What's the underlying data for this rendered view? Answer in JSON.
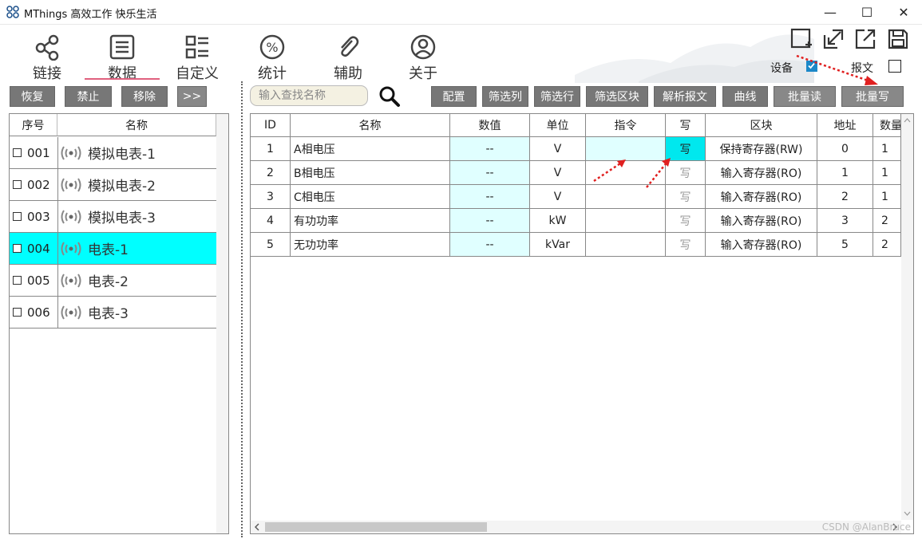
{
  "window": {
    "title": "MThings 高效工作 快乐生活",
    "controls": {
      "minimize": "—",
      "maximize": "☐",
      "close": "✕"
    }
  },
  "nav": {
    "items": [
      {
        "label": "链接",
        "icon": "share-icon"
      },
      {
        "label": "数据",
        "icon": "list-icon",
        "active": true
      },
      {
        "label": "自定义",
        "icon": "grid-list-icon"
      },
      {
        "label": "统计",
        "icon": "percent-icon"
      },
      {
        "label": "辅助",
        "icon": "paperclip-icon"
      },
      {
        "label": "关于",
        "icon": "user-icon"
      }
    ]
  },
  "toolbar_right": {
    "icons": [
      "add-window-icon",
      "import-icon",
      "export-icon",
      "save-icon"
    ],
    "device_label": "设备",
    "device_checked": true,
    "message_label": "报文",
    "message_checked": false
  },
  "left_buttons": {
    "restore": "恢复",
    "disable": "禁止",
    "remove": "移除",
    "more": ">>"
  },
  "search": {
    "placeholder": "输入查找名称"
  },
  "right_buttons": {
    "config": "配置",
    "filter_columns": "筛选列",
    "filter_rows": "筛选行",
    "filter_block": "筛选区块",
    "parse_message": "解析报文",
    "curve": "曲线",
    "batch_read": "批量读",
    "batch_write": "批量写"
  },
  "device_list": {
    "headers": {
      "num": "序号",
      "name": "名称"
    },
    "rows": [
      {
        "num": "001",
        "name": "模拟电表-1",
        "selected": false
      },
      {
        "num": "002",
        "name": "模拟电表-2",
        "selected": false
      },
      {
        "num": "003",
        "name": "模拟电表-3",
        "selected": false
      },
      {
        "num": "004",
        "name": "电表-1",
        "selected": true
      },
      {
        "num": "005",
        "name": "电表-2",
        "selected": false
      },
      {
        "num": "006",
        "name": "电表-3",
        "selected": false
      }
    ]
  },
  "data_table": {
    "headers": {
      "id": "ID",
      "name": "名称",
      "value": "数值",
      "unit": "单位",
      "command": "指令",
      "write": "写",
      "block": "区块",
      "address": "地址",
      "count": "数量"
    },
    "rows": [
      {
        "id": "1",
        "name": "A相电压",
        "value": "--",
        "unit": "V",
        "command": "",
        "write": "写",
        "write_enabled": true,
        "block": "保持寄存器(RW)",
        "address": "0",
        "count": "1"
      },
      {
        "id": "2",
        "name": "B相电压",
        "value": "--",
        "unit": "V",
        "command": "",
        "write": "写",
        "write_enabled": false,
        "block": "输入寄存器(RO)",
        "address": "1",
        "count": "1"
      },
      {
        "id": "3",
        "name": "C相电压",
        "value": "--",
        "unit": "V",
        "command": "",
        "write": "写",
        "write_enabled": false,
        "block": "输入寄存器(RO)",
        "address": "2",
        "count": "1"
      },
      {
        "id": "4",
        "name": "有功功率",
        "value": "--",
        "unit": "kW",
        "command": "",
        "write": "写",
        "write_enabled": false,
        "block": "输入寄存器(RO)",
        "address": "3",
        "count": "2"
      },
      {
        "id": "5",
        "name": "无功功率",
        "value": "--",
        "unit": "kVar",
        "command": "",
        "write": "写",
        "write_enabled": false,
        "block": "输入寄存器(RO)",
        "address": "5",
        "count": "2"
      }
    ]
  },
  "watermark": "CSDN @AlanBruce",
  "colors": {
    "selected_row": "#00ffff",
    "value_cell": "#e0ffff",
    "write_enabled": "#00e8ee",
    "button_gray": "#777777",
    "nav_underline": "#e0607e",
    "annotation_arrow": "#e02020"
  }
}
